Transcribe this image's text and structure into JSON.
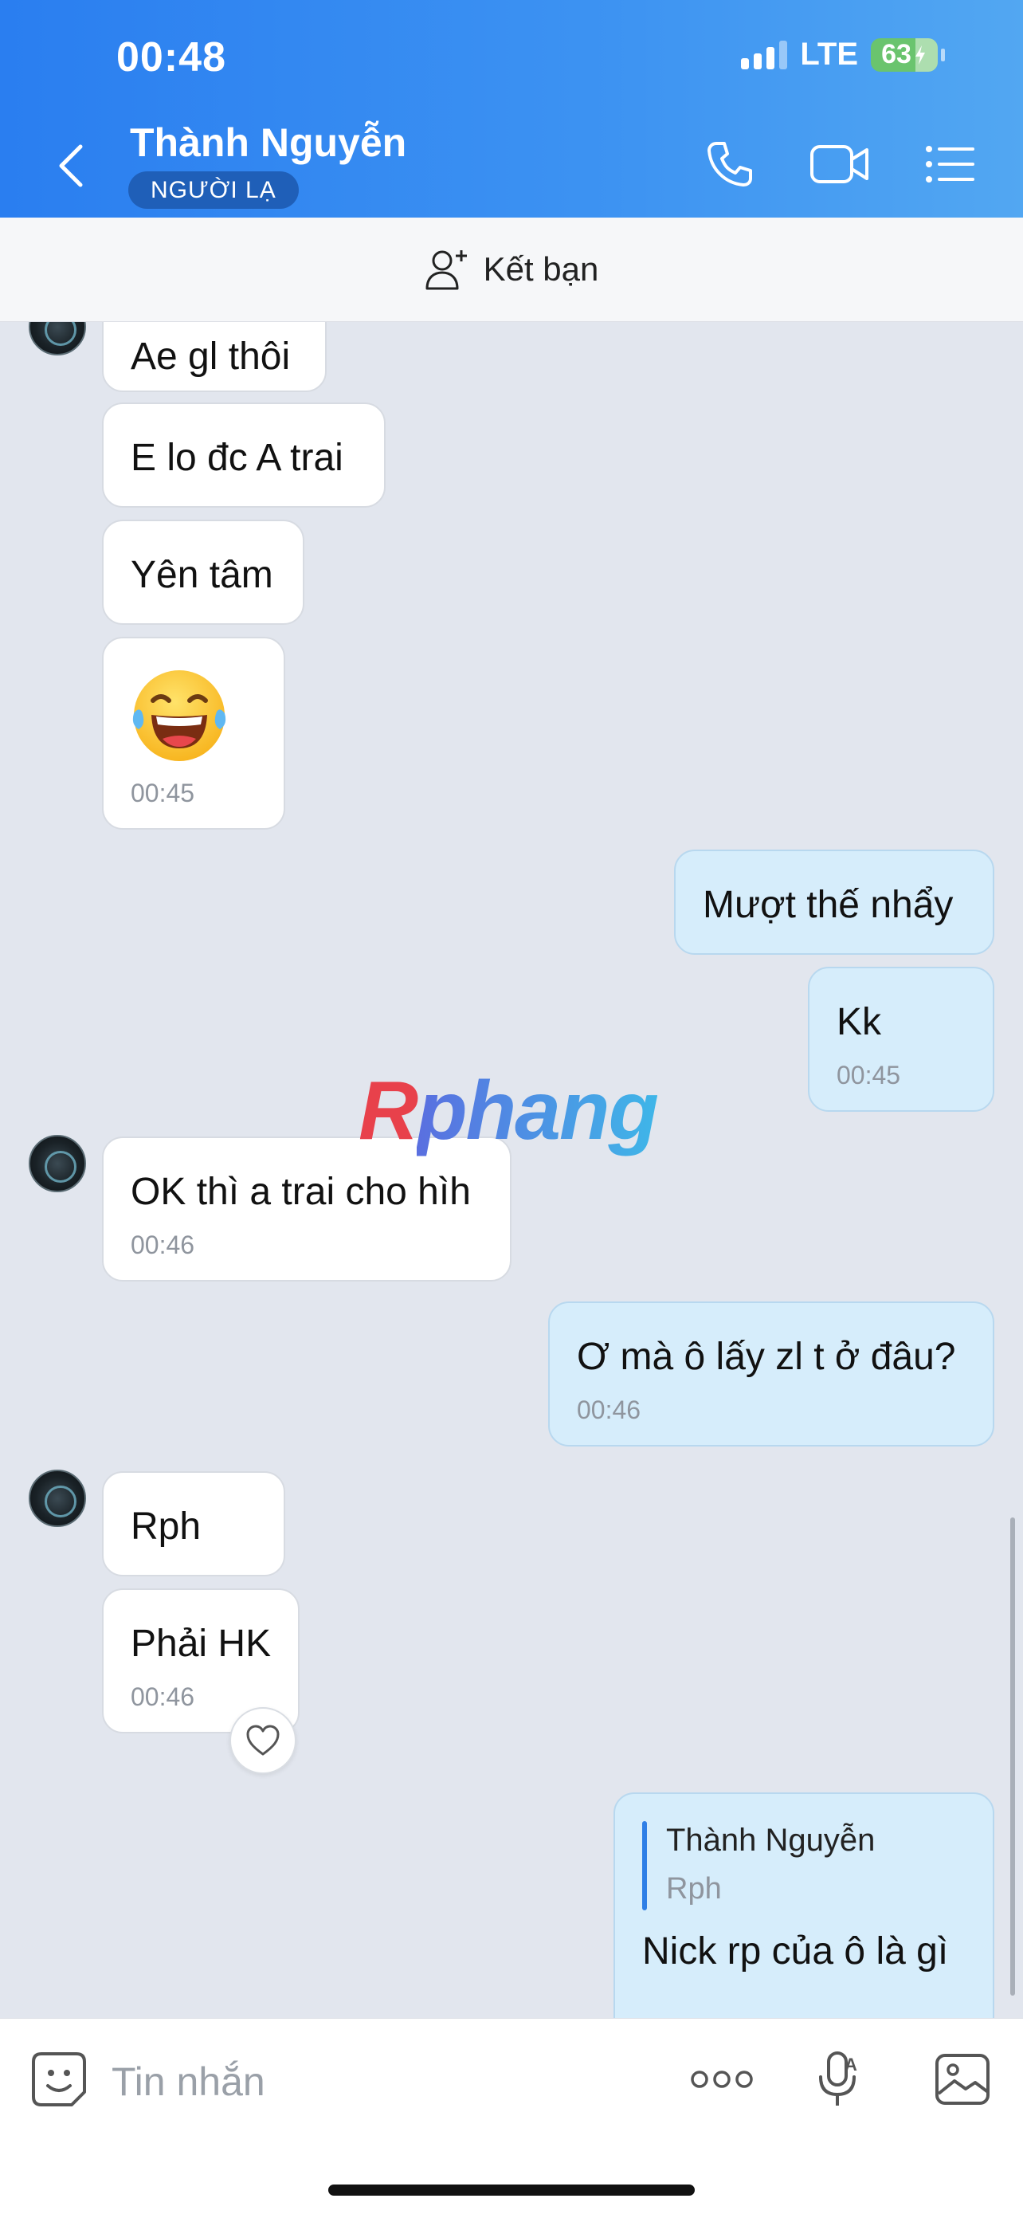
{
  "status_bar": {
    "time": "00:48",
    "network": "LTE",
    "battery": "63"
  },
  "header": {
    "contact_name": "Thành Nguyễn",
    "badge": "NGƯỜI LẠ"
  },
  "friend_bar": {
    "label": "Kết bạn"
  },
  "messages": [
    {
      "side": "in",
      "text": "Ae gl thôi"
    },
    {
      "side": "in",
      "text": "E lo đc A trai"
    },
    {
      "side": "in",
      "text": "Yên tâm"
    },
    {
      "side": "in",
      "type": "emoji",
      "emoji": "laughing-tears",
      "time": "00:45"
    },
    {
      "side": "out",
      "text": "Mượt thế nhẩy"
    },
    {
      "side": "out",
      "text": "Kk",
      "time": "00:45"
    },
    {
      "side": "in",
      "text": "OK thì a trai cho hìh",
      "time": "00:46"
    },
    {
      "side": "out",
      "text": "Ơ mà ô lấy zl t ở đâu?",
      "time": "00:46"
    },
    {
      "side": "in",
      "text": "Rph"
    },
    {
      "side": "in",
      "text": "Phải HK",
      "time": "00:46"
    },
    {
      "side": "out",
      "reply_to": {
        "name": "Thành Nguyễn",
        "text": "Rph"
      },
      "text": "Nick rp của ô là gì"
    }
  ],
  "watermark": {
    "first": "R",
    "rest": "phang"
  },
  "input": {
    "placeholder": "Tin nhắn"
  },
  "colors": {
    "header": "#2f85f0",
    "incoming_bubble": "#ffffff",
    "outgoing_bubble": "#d6edfb",
    "chat_bg": "#e2e6ee"
  }
}
